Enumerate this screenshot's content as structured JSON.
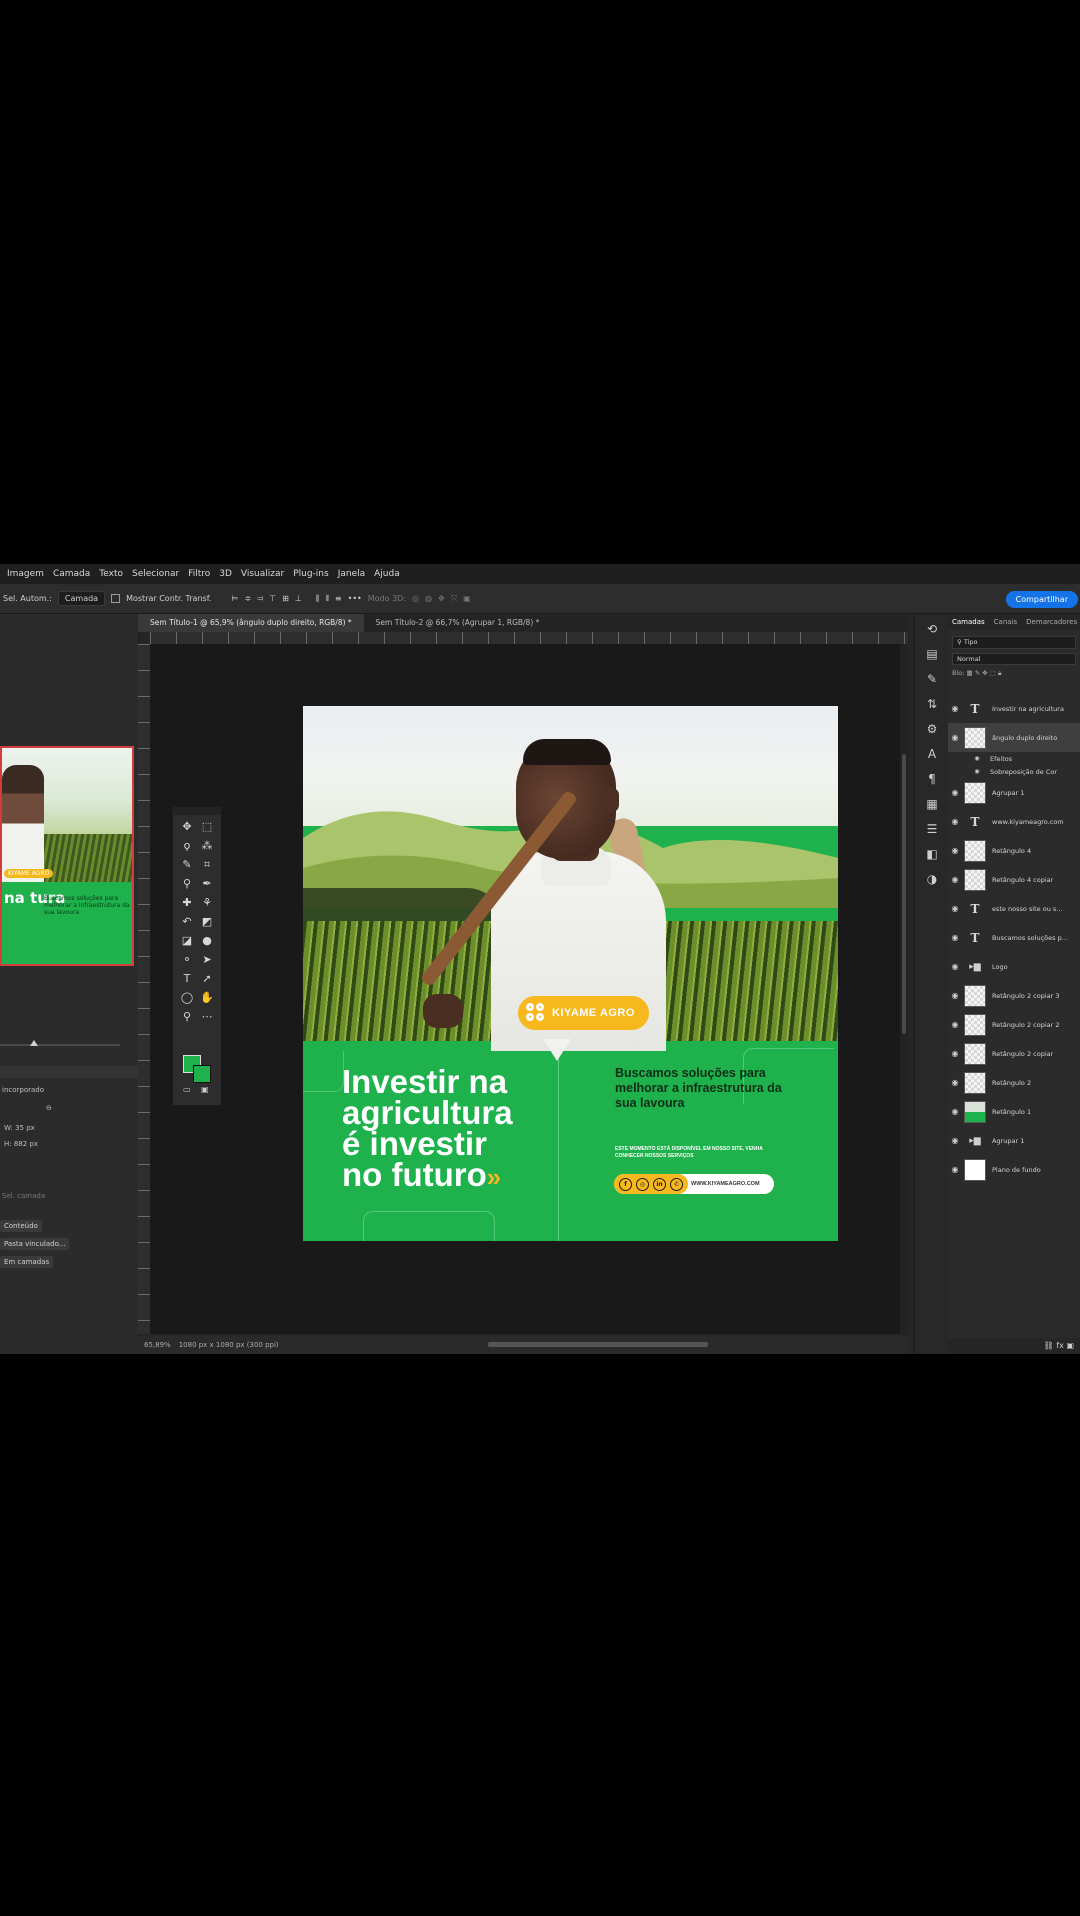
{
  "menu": [
    "Imagem",
    "Camada",
    "Texto",
    "Selecionar",
    "Filtro",
    "3D",
    "Visualizar",
    "Plug-ins",
    "Janela",
    "Ajuda"
  ],
  "options": {
    "auto_select": "Sel. Autom.:",
    "layer_select": "Camada",
    "show_transform": "Mostrar Contr. Transf.",
    "mode_3d": "Modo 3D:",
    "share_button": "Compartilhar"
  },
  "tabs": [
    {
      "label": "Sem Título-1 @ 65,9% (ângulo duplo direito, RGB/8) *",
      "active": true
    },
    {
      "label": "Sem Título-2 @ 66,7% (Agrupar 1, RGB/8) *",
      "active": false
    }
  ],
  "left_panel": {
    "header": "incorporado",
    "width": "W: 35 px",
    "height": "H: 882 px",
    "no_layer": "Sel. camada",
    "buttons": [
      "Conteúdo",
      "Pasta vinculado...",
      "Em camadas"
    ]
  },
  "status": {
    "zoom": "65,89%",
    "doc_size": "1080 px x 1080 px (300 ppi)"
  },
  "artwork": {
    "brand": "KIYAME AGRO",
    "headline_lines": [
      "Investir na",
      "agricultura",
      "é investir",
      "no futuro"
    ],
    "headline_chevron": "»",
    "subhead": "Buscamos soluções para melhorar a infraestrutura da sua lavoura",
    "small_text": "ESTE MOMENTO ESTÁ DISPONÍVEL EM NOSSO SITE, VENHA CONHECER NOSSOS SERVIÇOS",
    "social_icons": [
      "f",
      "◎",
      "in",
      "✆"
    ],
    "website": "WWW.KIYAMEAGRO.COM",
    "colors": {
      "green": "#1eb14c",
      "yellow": "#f6b81c",
      "dark_green": "#0d2e17"
    }
  },
  "thumb": {
    "headline": "na tura",
    "sub": "Buscamos soluções para melhorar a infraestrutura da sua lavoura",
    "badge": "KIYAME AGRO"
  },
  "layers_panel": {
    "tabs": [
      "Camadas",
      "Canais",
      "Demarcadores"
    ],
    "filter": "Tipo",
    "blend_mode": "Normal",
    "lock_label": "Blo:",
    "layers": [
      {
        "type": "text",
        "name": "Investir na agricultura"
      },
      {
        "type": "raster",
        "name": "ângulo duplo direito",
        "selected": true
      },
      {
        "type": "effect",
        "name": "Efeitos"
      },
      {
        "type": "effect",
        "name": "Sobreposição de Cor"
      },
      {
        "type": "raster",
        "name": "Agrupar 1"
      },
      {
        "type": "text",
        "name": "www.kiyameagro.com"
      },
      {
        "type": "raster",
        "name": "Retângulo 4"
      },
      {
        "type": "raster",
        "name": "Retângulo 4 copiar"
      },
      {
        "type": "text",
        "name": "este nosso site ou s..."
      },
      {
        "type": "text",
        "name": "Buscamos soluções p..."
      },
      {
        "type": "folder",
        "name": "Logo"
      },
      {
        "type": "raster",
        "name": "Retângulo 2 copiar 3"
      },
      {
        "type": "raster",
        "name": "Retângulo 2 copiar 2"
      },
      {
        "type": "raster",
        "name": "Retângulo 2 copiar"
      },
      {
        "type": "raster",
        "name": "Retângulo 2"
      },
      {
        "type": "photo",
        "name": "Retângulo 1"
      },
      {
        "type": "folder",
        "name": "Agrupar 1"
      },
      {
        "type": "white",
        "name": "Plano de fundo"
      }
    ]
  }
}
